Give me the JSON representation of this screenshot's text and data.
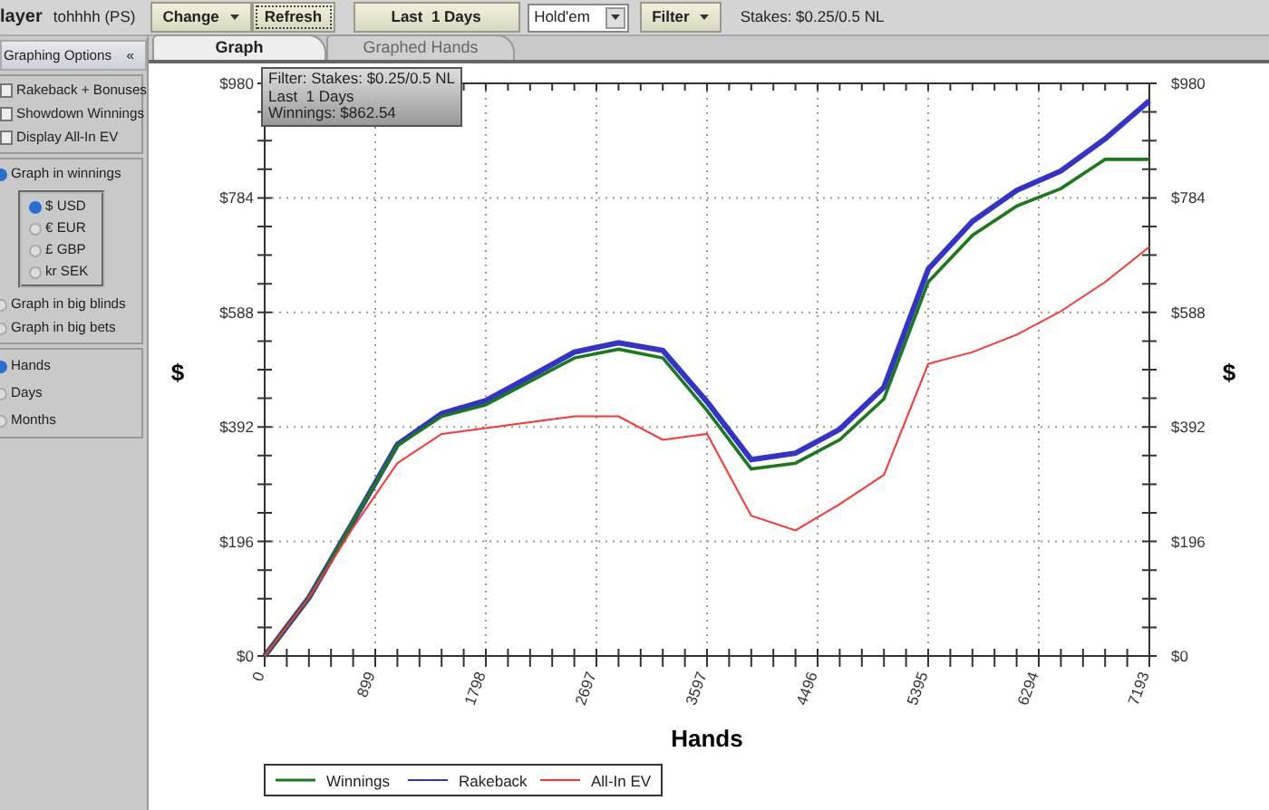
{
  "toolbar": {
    "player_label": "layer",
    "player_name": "tohhhh (PS)",
    "buttons": [
      {
        "label": "Change",
        "dropdown": true,
        "focused": false
      },
      {
        "label": "Refresh",
        "dropdown": false,
        "focused": true
      }
    ],
    "period_button": "Last  1 Days",
    "game_select": {
      "value": "Hold'em"
    },
    "filter_button": {
      "label": "Filter"
    },
    "stakes": "Stakes: $0.25/0.5 NL"
  },
  "sidebar": {
    "title": "Graphing Options",
    "collapse": "«",
    "checkboxes": [
      {
        "label": "Rakeback + Bonuses",
        "checked": false
      },
      {
        "label": "Showdown Winnings",
        "checked": false
      },
      {
        "label": "Display All-In EV",
        "checked": false
      }
    ],
    "graph_modes": [
      {
        "label": "Graph in winnings",
        "selected": true,
        "currencies": [
          {
            "label": "$ USD",
            "selected": true
          },
          {
            "label": "€ EUR",
            "selected": false
          },
          {
            "label": "£ GBP",
            "selected": false
          },
          {
            "label": "kr SEK",
            "selected": false
          }
        ]
      },
      {
        "label": "Graph in big blinds",
        "selected": false
      },
      {
        "label": "Graph in big bets",
        "selected": false
      }
    ],
    "x_axis_modes": [
      {
        "label": "Hands",
        "selected": true
      },
      {
        "label": "Days",
        "selected": false
      },
      {
        "label": "Months",
        "selected": false
      }
    ]
  },
  "tabs": [
    {
      "label": "Graph",
      "selected": true
    },
    {
      "label": "Graphed Hands",
      "selected": false
    }
  ],
  "filter_info": [
    "Filter: Stakes: $0.25/0.5 NL",
    "Last  1 Days",
    "Winnings: $862.54"
  ],
  "chart_data": {
    "type": "line",
    "xlabel": "Hands",
    "ylabel": "$",
    "grid": true,
    "legend": "bottom-left",
    "annotations": [
      "$"
    ],
    "x": [
      0,
      360,
      719,
      1079,
      1439,
      1798,
      2158,
      2518,
      2877,
      3237,
      3597,
      3956,
      4316,
      4676,
      5035,
      5395,
      5755,
      6115,
      6474,
      6834,
      7193
    ],
    "series": [
      {
        "name": "Winnings",
        "color": "#1a7a1a",
        "values": [
          0,
          100,
          230,
          360,
          410,
          430,
          470,
          510,
          525,
          510,
          420,
          320,
          330,
          370,
          440,
          640,
          720,
          770,
          800,
          850,
          850
        ]
      },
      {
        "name": "Rakeback",
        "color": "#3333cc",
        "values": [
          0,
          100,
          230,
          362,
          415,
          437,
          478,
          520,
          536,
          523,
          435,
          336,
          347,
          388,
          460,
          662,
          744,
          797,
          830,
          885,
          950
        ]
      },
      {
        "name": "All-In EV",
        "color": "#ff3333",
        "values": [
          0,
          100,
          220,
          330,
          380,
          390,
          400,
          410,
          410,
          370,
          380,
          240,
          215,
          260,
          310,
          500,
          520,
          550,
          590,
          640,
          700
        ]
      }
    ],
    "xlim": [
      0,
      7193
    ],
    "ylim": [
      0,
      980
    ],
    "xticks": [
      0,
      899,
      1798,
      2697,
      3597,
      4496,
      5395,
      6294,
      7193
    ],
    "yticks": [
      {
        "value": 0,
        "label": "$0"
      },
      {
        "value": 196,
        "label": "$196"
      },
      {
        "value": 392,
        "label": "$392"
      },
      {
        "value": 588,
        "label": "$588"
      },
      {
        "value": 784,
        "label": "$784"
      },
      {
        "value": 980,
        "label": "$980"
      }
    ]
  }
}
